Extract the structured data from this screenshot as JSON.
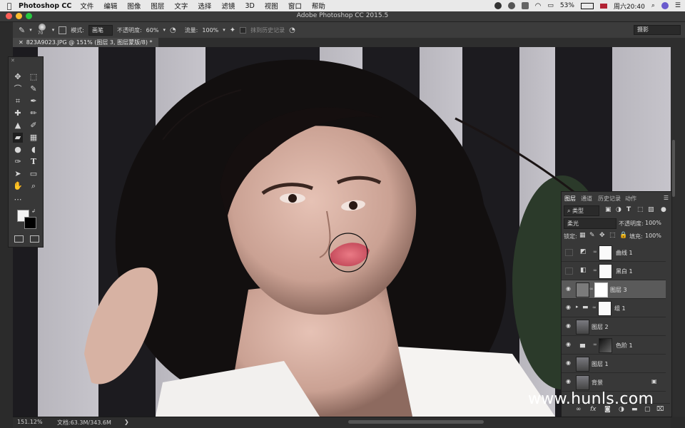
{
  "menubar": {
    "app_name": "Photoshop CC",
    "items": [
      "文件",
      "编辑",
      "图像",
      "图层",
      "文字",
      "选择",
      "滤镜",
      "3D",
      "视图",
      "窗口",
      "帮助"
    ],
    "battery": "53%",
    "clock": "周六20:40"
  },
  "window": {
    "title": "Adobe Photoshop CC 2015.5"
  },
  "options": {
    "brush_size": "70",
    "mode_label": "模式:",
    "mode_value": "画笔",
    "opacity_label": "不透明度:",
    "opacity_value": "60%",
    "flow_label": "流量:",
    "flow_value": "100%",
    "history_label": "抹到历史记录",
    "workspace": "摄影"
  },
  "document": {
    "tab_title": "823A9023.JPG @ 151% (图层 3, 图层蒙版/8) *"
  },
  "status": {
    "zoom": "151.12%",
    "doc_size": "文档:63.3M/343.6M"
  },
  "layers_panel": {
    "tabs": [
      "图层",
      "通道",
      "历史记录",
      "动作"
    ],
    "filter_type": "类型",
    "blend_mode": "柔光",
    "opacity_label": "不透明度:",
    "opacity_value": "100%",
    "lock_label": "锁定:",
    "fill_label": "填充:",
    "fill_value": "100%",
    "layers": [
      {
        "name": "曲线 1",
        "visible": false
      },
      {
        "name": "黑白 1",
        "visible": false
      },
      {
        "name": "图层 3",
        "visible": true,
        "selected": true
      },
      {
        "name": "组 1",
        "visible": true
      },
      {
        "name": "图层 2",
        "visible": true
      },
      {
        "name": "色阶 1",
        "visible": true
      },
      {
        "name": "图层 1",
        "visible": true
      },
      {
        "name": "背景",
        "visible": true,
        "locked": true
      }
    ]
  },
  "watermark": "www.hunls.com",
  "colors": {
    "accent": "#4a90e2",
    "panel_bg": "#383838",
    "canvas_bg": "#1a1a1a"
  }
}
